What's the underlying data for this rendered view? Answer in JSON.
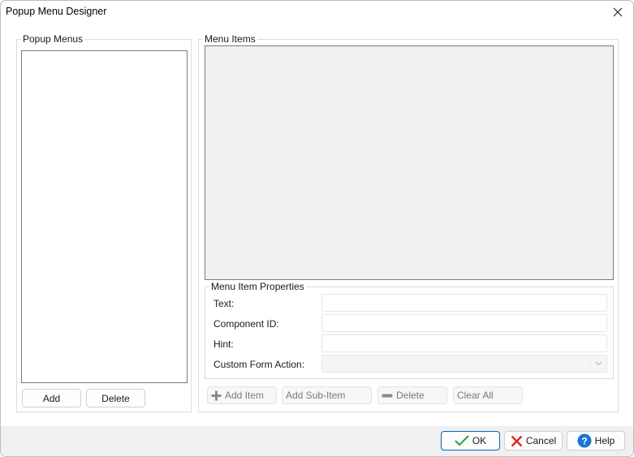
{
  "window": {
    "title": "Popup Menu Designer",
    "close_icon": "close-icon"
  },
  "popup_menus": {
    "legend": "Popup Menus",
    "items": [],
    "add_label": "Add",
    "delete_label": "Delete"
  },
  "menu_items": {
    "legend": "Menu Items",
    "items": []
  },
  "properties": {
    "legend": "Menu Item Properties",
    "text_label": "Text:",
    "text_value": "",
    "component_id_label": "Component ID:",
    "component_id_value": "",
    "hint_label": "Hint:",
    "hint_value": "",
    "custom_form_action_label": "Custom Form Action:",
    "custom_form_action_value": ""
  },
  "item_toolbar": {
    "add_item_label": "Add Item",
    "add_item_icon": "plus-icon",
    "add_sub_item_label": "Add Sub-Item",
    "delete_label": "Delete",
    "delete_icon": "minus-icon",
    "clear_all_label": "Clear All"
  },
  "footer": {
    "ok_label": "OK",
    "ok_icon": "checkmark-icon",
    "cancel_label": "Cancel",
    "cancel_icon": "x-icon",
    "help_label": "Help",
    "help_icon": "question-icon",
    "colors": {
      "ok_check": "#2e9e3e",
      "cancel_x": "#e0262a",
      "help_circle": "#1b76d2"
    }
  }
}
